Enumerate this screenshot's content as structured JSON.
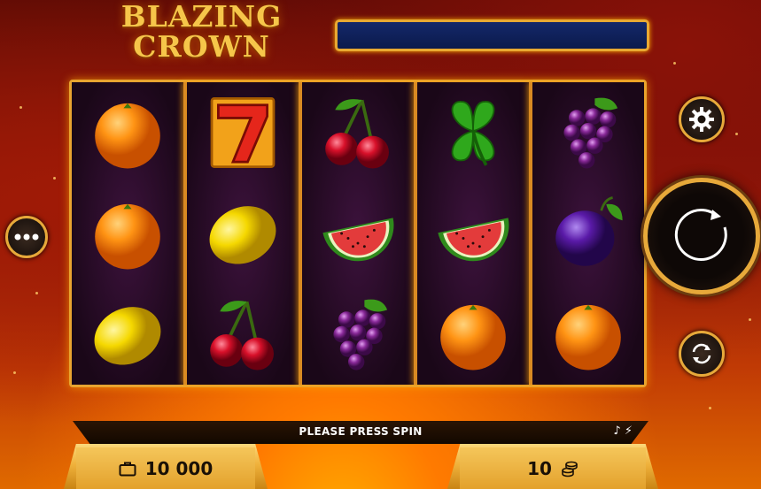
{
  "game": {
    "logo_line1": "BLAZING",
    "logo_line2": "CROWN"
  },
  "reels": [
    {
      "symbols": [
        "orange-icon",
        "orange-icon",
        "lemon-icon"
      ]
    },
    {
      "symbols": [
        "seven-icon",
        "lemon-icon",
        "cherry-icon"
      ]
    },
    {
      "symbols": [
        "cherry-icon",
        "watermelon-icon",
        "grape-icon"
      ]
    },
    {
      "symbols": [
        "clover-icon",
        "watermelon-icon",
        "orange-icon"
      ]
    },
    {
      "symbols": [
        "grape-icon",
        "plum-icon",
        "orange-icon"
      ]
    }
  ],
  "message_bar": {
    "text": "PLEASE PRESS SPIN",
    "icons": [
      "music-note-icon",
      "lightning-icon"
    ]
  },
  "balance": {
    "icon": "briefcase-icon",
    "value": "10 000"
  },
  "bet": {
    "icon": "coin-stack-icon",
    "value": "10"
  },
  "controls": {
    "menu": "more-dots-icon",
    "settings": "gear-icon",
    "spin": "spin-arrow-icon",
    "autoplay": "autoplay-icon"
  },
  "colors": {
    "gold": "#e8a430",
    "win_bar": "#14286a",
    "reel_bg": "#2a0c28"
  }
}
